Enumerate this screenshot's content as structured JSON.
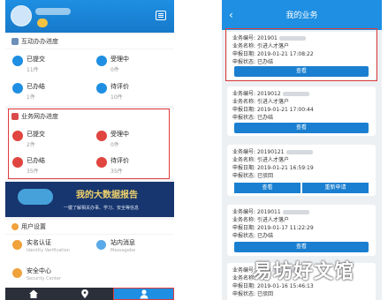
{
  "left": {
    "header": {
      "badge": ""
    },
    "section_interact": {
      "title": "互动办办进度",
      "items": [
        {
          "label": "已提交",
          "count": "11件"
        },
        {
          "label": "受理中",
          "count": "0件"
        },
        {
          "label": "已办结",
          "count": "1件"
        },
        {
          "label": "待评价",
          "count": "10件"
        }
      ]
    },
    "section_online": {
      "title": "业务网办进度",
      "items": [
        {
          "label": "已提交",
          "count": "2件"
        },
        {
          "label": "受理中",
          "count": "0件"
        },
        {
          "label": "已办结",
          "count": "35件"
        },
        {
          "label": "待评价",
          "count": "35件"
        }
      ]
    },
    "banner": {
      "title": "我的大数据报告",
      "subtitle": "一键了解相关办事、学习、安全等信息"
    },
    "user_settings": {
      "title": "用户设置",
      "items": [
        {
          "label": "实名认证",
          "sub": "Identity Verification"
        },
        {
          "label": "站内消息",
          "sub": "Messagebe"
        },
        {
          "label": "安全中心",
          "sub": "Security Center"
        }
      ]
    }
  },
  "right": {
    "title": "我的业务",
    "labels": {
      "number": "业务编号:",
      "name": "业务名称:",
      "date": "申报日期:",
      "status": "申报状态:"
    },
    "view_label": "查看",
    "reapply_label": "重新申请",
    "cards": [
      {
        "number": "201901",
        "name": "引进人才落户",
        "date": "2019-01-21 17:08:22",
        "status": "已办结"
      },
      {
        "number": "2019012",
        "name": "引进人才落户",
        "date": "2019-01-21 17:00:44",
        "status": "已办结"
      },
      {
        "number": "20190121",
        "name": "引进人才落户",
        "date": "2019-01-21 16:59:19",
        "status": "已驳回"
      },
      {
        "number": "2019011",
        "name": "引进人才落户",
        "date": "2019-01-17 11:22:29",
        "status": "已办结"
      },
      {
        "number": "2019",
        "name": "",
        "date": "2019-01-16 15:46:13",
        "status": "已驳回"
      }
    ]
  },
  "watermark": "易坊好文馆",
  "colors": {
    "primary": "#1e8fe2",
    "highlight": "#e13a3a",
    "button": "#1a7fd0"
  }
}
